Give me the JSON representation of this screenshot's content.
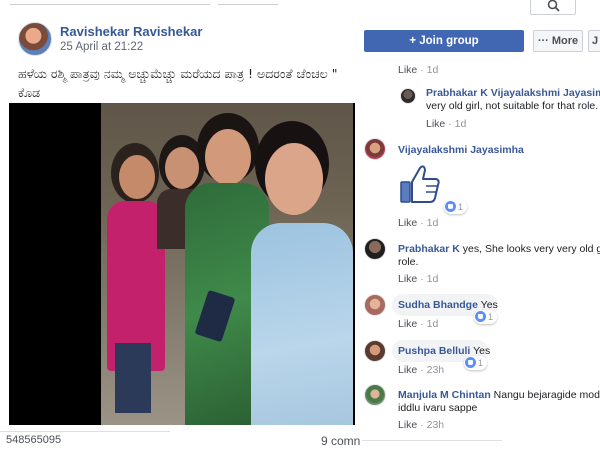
{
  "post": {
    "author": "Ravishekar Ravishekar",
    "timestamp": "25 April at 21:22",
    "caption_line1": "ಹಳೆಯ ರಶ್ಮಿ ಪಾತ್ರವು ನಮ್ಮ ಅಚ್ಚುಮೆಚ್ಚು ಮರೆಯದ ಪಾತ್ರ ! ಅದರಂತೆ ಚೆಂಚಲ \" ",
    "caption_line2": "ಕೊಡ",
    "footer_id": "548565095",
    "comment_count": "9 comn"
  },
  "group": {
    "join_label": "+ Join group",
    "more_label": "··· More",
    "edge_label": "J"
  },
  "comments": [
    {
      "meta_time": "1d"
    },
    {
      "name": "Prabhakar K",
      "text_inline": "Vijayalakshmi Jayasimha",
      "text_rest": " y",
      "line2": "very old girl, not suitable for that role.",
      "time": "1d"
    },
    {
      "name": "Vijayalakshmi Jayasimha",
      "reaction_count": "1",
      "time": "1d",
      "sticker": "thumbs-up"
    },
    {
      "name": "Prabhakar K",
      "line1": "yes, She looks very very old girl,",
      "line2": "role.",
      "time": "1d"
    },
    {
      "name": "Sudha Bhandge",
      "text": "Yes",
      "reaction_count": "1",
      "time": "1d"
    },
    {
      "name": "Pushpa Belluli",
      "text": "Yes",
      "reaction_count": "1",
      "time": "23h"
    },
    {
      "name": "Manjula M Chintan",
      "line1": "Nangu bejaragide modalin",
      "line2": "iddlu ivaru sappe",
      "time": "23h"
    }
  ],
  "labels": {
    "like": "Like",
    "sep": " · "
  },
  "colors": {
    "accent": "#4267b2",
    "name_link": "#385898",
    "meta_gray": "#90949c",
    "bubble": "#f2f3f5"
  }
}
